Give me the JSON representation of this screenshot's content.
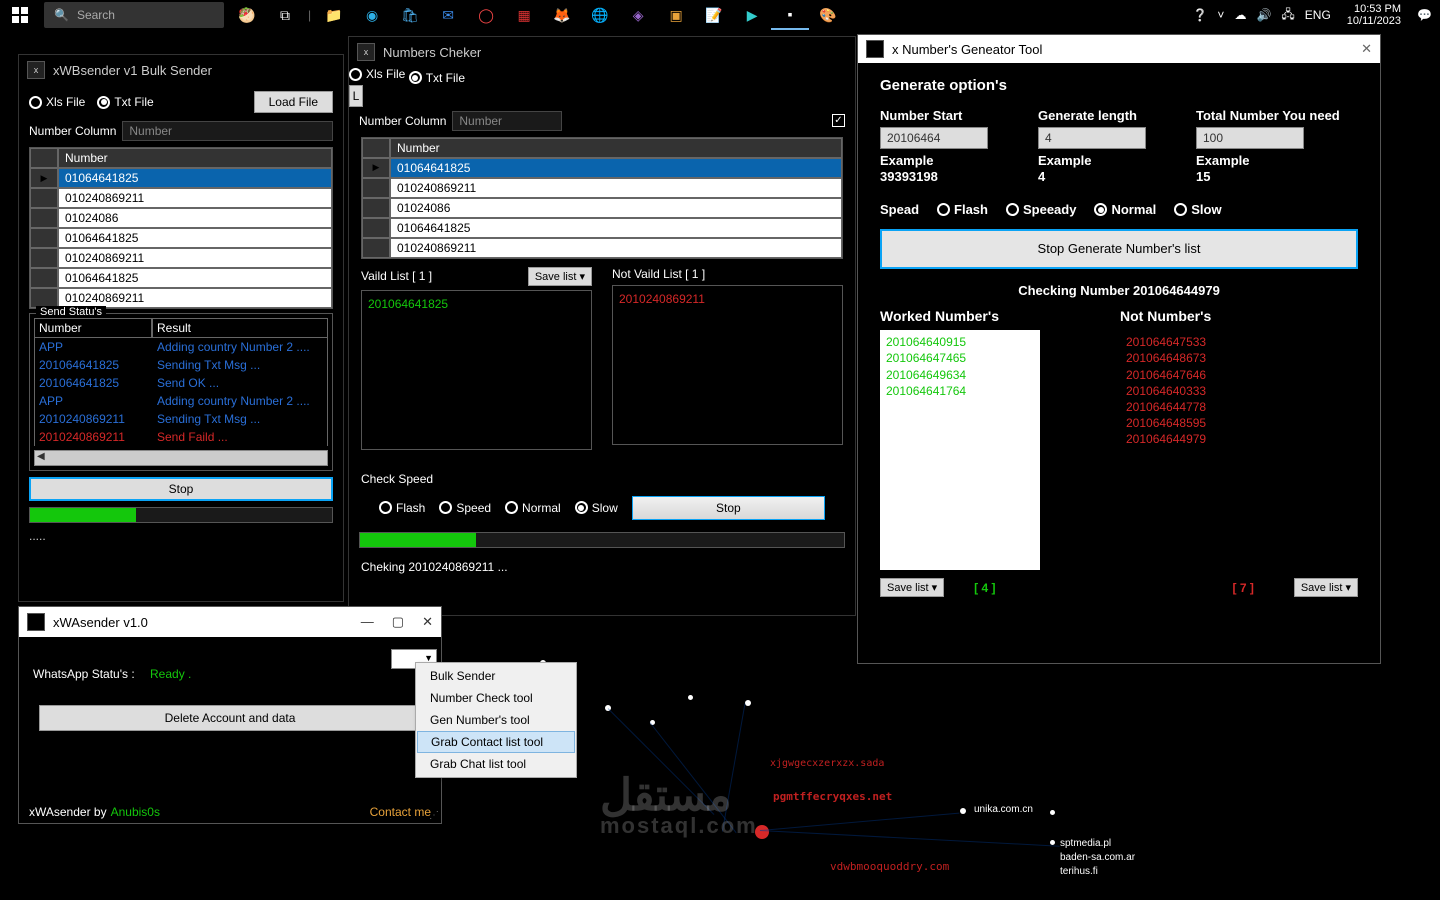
{
  "taskbar": {
    "search_placeholder": "Search",
    "lang": "ENG",
    "time": "10:53 PM",
    "date": "10/11/2023"
  },
  "bulk": {
    "title": "xWBsender v1 Bulk Sender",
    "xls": "Xls File",
    "txt": "Txt File",
    "loadfile": "Load File",
    "numcol": "Number Column",
    "numcol_ph": "Number",
    "col_number": "Number",
    "rows": [
      "01064641825",
      "010240869211",
      "01024086",
      "01064641825",
      "010240869211",
      "01064641825",
      "010240869211"
    ],
    "send_status": "Send Statu's",
    "sh_number": "Number",
    "sh_result": "Result",
    "log": [
      {
        "n": "APP",
        "r": "Adding country Number 2 ....",
        "cls": "blue"
      },
      {
        "n": "201064641825",
        "r": "Sending Txt Msg ...",
        "cls": "blue"
      },
      {
        "n": "201064641825",
        "r": "Send OK ...",
        "cls": "blue"
      },
      {
        "n": "APP",
        "r": "Adding country Number 2 ....",
        "cls": "blue"
      },
      {
        "n": "2010240869211",
        "r": "Sending Txt Msg ...",
        "cls": "blue"
      },
      {
        "n": "2010240869211",
        "r": "Send Faild ...",
        "cls": "red"
      }
    ],
    "stop": "Stop",
    "dots": "....."
  },
  "checker": {
    "title": "Numbers Cheker",
    "xls": "Xls File",
    "txt": "Txt File",
    "load": "L",
    "numcol": "Number Column",
    "numcol_ph": "Number",
    "col_number": "Number",
    "rows": [
      "01064641825",
      "010240869211",
      "01024086",
      "01064641825",
      "010240869211"
    ],
    "valid_label": "Vaild List [ 1 ]",
    "notvalid_label": "Not Vaild List [ 1 ]",
    "save": "Save list ▾",
    "valid_item": "201064641825",
    "notvalid_item": "2010240869211",
    "check_speed": "Check Speed",
    "flash": "Flash",
    "speed": "Speed",
    "normal": "Normal",
    "slow": "Slow",
    "stop": "Stop",
    "checking": "Cheking 2010240869211 ..."
  },
  "gen": {
    "title": "x Number's Geneator Tool",
    "h": "Generate option's",
    "ns": "Number Start",
    "ns_v": "20106464",
    "gl": "Generate length",
    "gl_v": "4",
    "tn": "Total Number You need",
    "tn_v": "100",
    "ex": "Example",
    "ex_ns": "39393198",
    "ex_gl": "4",
    "ex_tn": "15",
    "spead": "Spead",
    "flash": "Flash",
    "speeady": "Speeady",
    "normal": "Normal",
    "slow": "Slow",
    "stop": "Stop Generate Number's list",
    "checking": "Checking Number 201064644979",
    "worked": "Worked Number's",
    "notnum": "Not Number's",
    "worked_list": [
      "201064640915",
      "201064647465",
      "201064649634",
      "201064641764"
    ],
    "not_list": [
      "201064647533",
      "201064648673",
      "201064647646",
      "201064640333",
      "201064644778",
      "201064648595",
      "201064644979"
    ],
    "save": "Save list ▾",
    "count_w": "[ 4 ]",
    "count_n": "[ 7 ]"
  },
  "sender": {
    "title": "xWAsender v1.0",
    "status_label": "WhatsApp Statu's :",
    "status_val": "Ready .",
    "delete": "Delete Account and data",
    "footer": "xWAsender  by",
    "author": "Anubis0s",
    "contact": "Contact me"
  },
  "menu": {
    "items": [
      "Bulk Sender",
      "Number Check tool",
      "Gen Number's tool",
      "Grab Contact list tool",
      "Grab Chat list tool"
    ],
    "sel_index": 3
  },
  "bg": {
    "t1": "sptmedia.pl",
    "t2": "baden-sa.com.ar",
    "t3": "terihus.fi",
    "t4": "unika.com.cn",
    "w1": "مستقل",
    "w2": "mostaql.com"
  }
}
